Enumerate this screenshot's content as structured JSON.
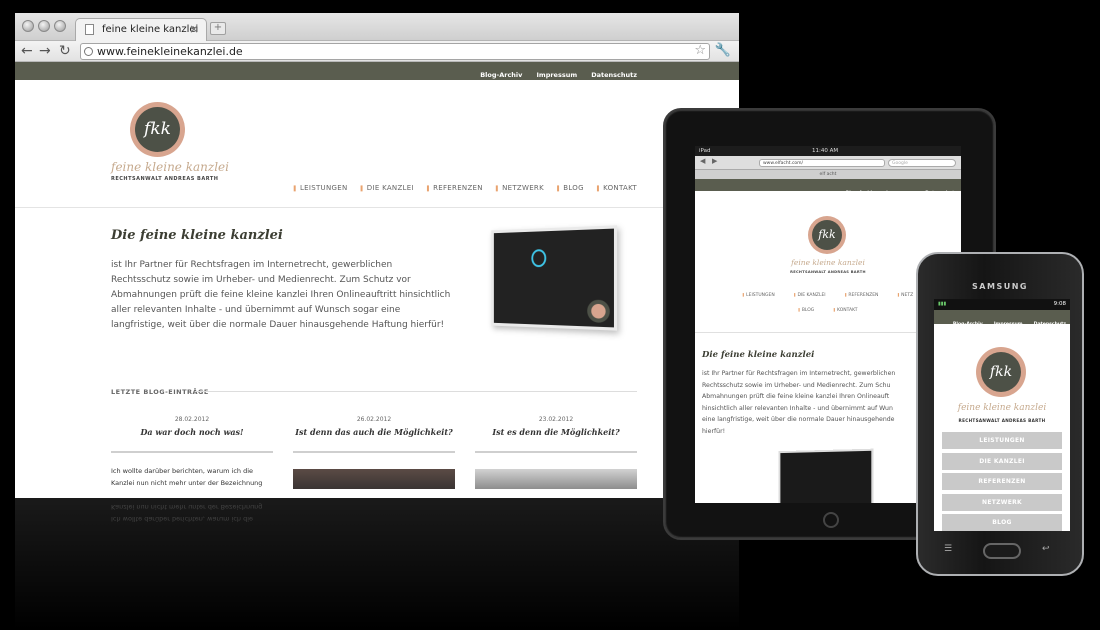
{
  "browser": {
    "tab_title": "feine kleine kanzlei",
    "new_tab_symbol": "+",
    "close_symbol": "×",
    "url": "www.feinekleinekanzlei.de"
  },
  "site": {
    "top_nav": [
      "Blog-Archiv",
      "Impressum",
      "Datenschutz"
    ],
    "logo_monogram": "fkk",
    "brand": "feine kleine kanzlei",
    "brand_sub": "RECHTSANWALT ANDREAS BARTH",
    "main_nav": [
      "LEISTUNGEN",
      "DIE KANZLEI",
      "REFERENZEN",
      "NETZWERK",
      "BLOG",
      "KONTAKT"
    ],
    "heading": "Die feine kleine kanzlei",
    "intro": "ist Ihr Partner für Rechtsfragen im Internetrecht, gewerblichen Rechtsschutz sowie im Urheber- und Medienrecht. Zum Schutz vor Abmahnungen prüft die feine kleine kanzlei Ihren Onlineauftritt hinsichtlich aller relevanten Inhalte - und übernimmt auf Wunsch sogar eine langfristige, weit über die normale Dauer hinausgehende Haftung hierfür!",
    "blog_label": "LETZTE BLOG-EINTRÄGE",
    "posts": [
      {
        "date": "28.02.2012",
        "title": "Da war doch noch was!",
        "excerpt": "Ich wollte darüber berichten, warum ich die Kanzlei nun nicht mehr unter der Bezeichnung"
      },
      {
        "date": "26.02.2012",
        "title": "Ist denn das auch die Möglichkeit?",
        "excerpt": ""
      },
      {
        "date": "23.02.2012",
        "title": "Ist es denn die Möglichkeit?",
        "excerpt": ""
      }
    ]
  },
  "ipad": {
    "carrier": "iPad",
    "time": "11:40 AM",
    "url": "www.elfacht.com/",
    "search_placeholder": "Google",
    "tab_title": "elf acht",
    "top_nav": [
      "Blog-Archiv",
      "Impressum",
      "Datenschutz"
    ],
    "brand": "feine kleine kanzlei",
    "brand_sub": "RECHTSANWALT ANDREAS BARTH",
    "menu_row1": [
      "LEISTUNGEN",
      "DIE KANZLEI",
      "REFERENZEN",
      "NETZ"
    ],
    "menu_row2": [
      "BLOG",
      "KONTAKT"
    ],
    "heading": "Die feine kleine kanzlei",
    "lines": [
      "ist Ihr Partner für Rechtsfragen im Internetrecht, gewerblichen",
      "Rechtsschutz sowie im Urheber- und Medienrecht. Zum Schu",
      "Abmahnungen prüft die feine kleine kanzlei Ihren Onlineauft",
      "hinsichtlich aller relevanten Inhalte - und übernimmt auf Wun",
      "eine langfristige, weit über die normale Dauer hinausgehende",
      "hierfür!"
    ]
  },
  "phone": {
    "maker": "SAMSUNG",
    "time": "9:08",
    "top_nav": [
      "Blog-Archiv",
      "Impressum",
      "Datenschutz"
    ],
    "brand": "feine kleine kanzlei",
    "brand_sub": "RECHTSANWALT ANDREAS BARTH",
    "menu": [
      "LEISTUNGEN",
      "DIE KANZLEI",
      "REFERENZEN",
      "NETZWERK",
      "BLOG"
    ]
  },
  "colors": {
    "nav_bar": "#5a5d4f",
    "accent": "#e9a36f",
    "logo_ring": "#d8a58f"
  }
}
